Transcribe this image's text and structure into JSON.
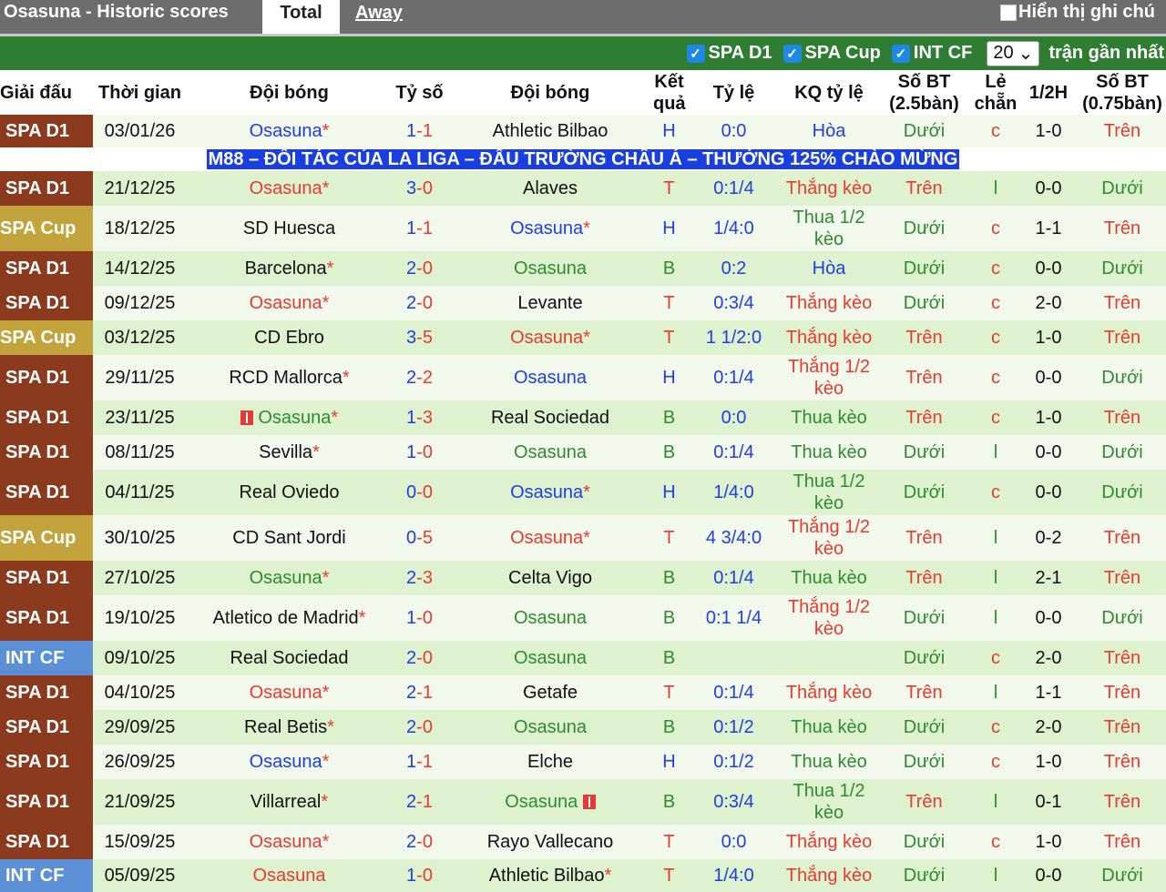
{
  "header": {
    "title": "Osasuna - Historic scores",
    "tab_total": "Total",
    "tab_away": "Away",
    "show_notes": "Hiển thị ghi chú"
  },
  "filters": {
    "spa_d1": "SPA D1",
    "spa_cup": "SPA Cup",
    "int_cf": "INT CF",
    "count": "20",
    "recent_label": "trận gần nhất"
  },
  "columns": [
    "Giải đấu",
    "Thời gian",
    "Đội bóng",
    "Tỷ số",
    "Đội bóng",
    "Kết quả",
    "Tỷ lệ",
    "KQ tỷ lệ",
    "Số BT (2.5bàn)",
    "Lẻ chẵn",
    "1/2H",
    "Số BT (0.75bàn)"
  ],
  "ad_banner": "M88 – ĐỐI TÁC CỦA LA LIGA – ĐẤU TRƯỜNG CHÂU Á – THƯỞNG 125% CHÀO MỪNG",
  "colors": {
    "spa_d1": "#8b3a1e",
    "spa_cup": "#c3a33b",
    "int_cf": "#5b8fd6",
    "blue": "#1e3ee6",
    "red": "#e63b2e",
    "green": "#2e8b2e"
  },
  "rows": [
    {
      "league": "SPA D1",
      "date": "03/01/26",
      "home": "Osasuna",
      "home_star": "*",
      "home_c": "blue",
      "score_a": "1",
      "score_b": "1",
      "away": "Athletic Bilbao",
      "away_star": "",
      "away_c": "dark",
      "result": "H",
      "result_c": "blue",
      "odds": "0:0",
      "odds_c": "blue",
      "kq": "Hòa",
      "kq_c": "blue",
      "bt25": "Dưới",
      "bt25_c": "green",
      "le": "c",
      "le_c": "red",
      "half": "1-0",
      "bt075": "Trên",
      "bt075_c": "red",
      "h": 36
    },
    {
      "ad": true
    },
    {
      "league": "SPA D1",
      "date": "21/12/25",
      "home": "Osasuna",
      "home_star": "*",
      "home_c": "red",
      "score_a": "3",
      "score_b": "0",
      "away": "Alaves",
      "away_star": "",
      "away_c": "dark",
      "result": "T",
      "result_c": "red",
      "odds": "0:1/4",
      "odds_c": "blue",
      "kq": "Thắng kèo",
      "kq_c": "red",
      "bt25": "Trên",
      "bt25_c": "red",
      "le": "l",
      "le_c": "green",
      "half": "0-0",
      "bt075": "Dưới",
      "bt075_c": "green",
      "h": 38
    },
    {
      "league": "SPA Cup",
      "date": "18/12/25",
      "home": "SD Huesca",
      "home_star": "",
      "home_c": "dark",
      "score_a": "1",
      "score_b": "1",
      "away": "Osasuna",
      "away_star": "*",
      "away_c": "blue",
      "result": "H",
      "result_c": "blue",
      "odds": "1/4:0",
      "odds_c": "blue",
      "kq": "Thua 1/2 kèo",
      "kq_c": "green",
      "bt25": "Dưới",
      "bt25_c": "green",
      "le": "c",
      "le_c": "red",
      "half": "1-1",
      "bt075": "Trên",
      "bt075_c": "red",
      "h": 50
    },
    {
      "league": "SPA D1",
      "date": "14/12/25",
      "home": "Barcelona",
      "home_star": "*",
      "home_c": "dark",
      "score_a": "2",
      "score_b": "0",
      "away": "Osasuna",
      "away_star": "",
      "away_c": "green",
      "result": "B",
      "result_c": "green",
      "odds": "0:2",
      "odds_c": "blue",
      "kq": "Hòa",
      "kq_c": "blue",
      "bt25": "Dưới",
      "bt25_c": "green",
      "le": "c",
      "le_c": "red",
      "half": "0-0",
      "bt075": "Dưới",
      "bt075_c": "green",
      "h": 38
    },
    {
      "league": "SPA D1",
      "date": "09/12/25",
      "home": "Osasuna",
      "home_star": "*",
      "home_c": "red",
      "score_a": "2",
      "score_b": "0",
      "away": "Levante",
      "away_star": "",
      "away_c": "dark",
      "result": "T",
      "result_c": "red",
      "odds": "0:3/4",
      "odds_c": "blue",
      "kq": "Thắng kèo",
      "kq_c": "red",
      "bt25": "Dưới",
      "bt25_c": "green",
      "le": "c",
      "le_c": "red",
      "half": "2-0",
      "bt075": "Trên",
      "bt075_c": "red",
      "h": 38
    },
    {
      "league": "SPA Cup",
      "date": "03/12/25",
      "home": "CD Ebro",
      "home_star": "",
      "home_c": "dark",
      "score_a": "3",
      "score_b": "5",
      "away": "Osasuna",
      "away_star": "*",
      "away_c": "red",
      "result": "T",
      "result_c": "red",
      "odds": "1 1/2:0",
      "odds_c": "blue",
      "kq": "Thắng kèo",
      "kq_c": "red",
      "bt25": "Trên",
      "bt25_c": "red",
      "le": "c",
      "le_c": "red",
      "half": "1-0",
      "bt075": "Trên",
      "bt075_c": "red",
      "h": 38
    },
    {
      "league": "SPA D1",
      "date": "29/11/25",
      "home": "RCD Mallorca",
      "home_star": "*",
      "home_c": "dark",
      "score_a": "2",
      "score_b": "2",
      "away": "Osasuna",
      "away_star": "",
      "away_c": "blue",
      "result": "H",
      "result_c": "blue",
      "odds": "0:1/4",
      "odds_c": "blue",
      "kq": "Thắng 1/2 kèo",
      "kq_c": "red",
      "bt25": "Trên",
      "bt25_c": "red",
      "le": "c",
      "le_c": "red",
      "half": "0-0",
      "bt075": "Dưới",
      "bt075_c": "green",
      "h": 50
    },
    {
      "league": "SPA D1",
      "date": "23/11/25",
      "home": "Osasuna",
      "home_star": "*",
      "home_c": "green",
      "home_flag": true,
      "score_a": "1",
      "score_b": "3",
      "away": "Real Sociedad",
      "away_star": "",
      "away_c": "dark",
      "result": "B",
      "result_c": "green",
      "odds": "0:0",
      "odds_c": "blue",
      "kq": "Thua kèo",
      "kq_c": "green",
      "bt25": "Trên",
      "bt25_c": "red",
      "le": "c",
      "le_c": "red",
      "half": "1-0",
      "bt075": "Trên",
      "bt075_c": "red",
      "h": 38
    },
    {
      "league": "SPA D1",
      "date": "08/11/25",
      "home": "Sevilla",
      "home_star": "*",
      "home_c": "dark",
      "score_a": "1",
      "score_b": "0",
      "away": "Osasuna",
      "away_star": "",
      "away_c": "green",
      "result": "B",
      "result_c": "green",
      "odds": "0:1/4",
      "odds_c": "blue",
      "kq": "Thua kèo",
      "kq_c": "green",
      "bt25": "Dưới",
      "bt25_c": "green",
      "le": "l",
      "le_c": "green",
      "half": "0-0",
      "bt075": "Dưới",
      "bt075_c": "green",
      "h": 38
    },
    {
      "league": "SPA D1",
      "date": "04/11/25",
      "home": "Real Oviedo",
      "home_star": "",
      "home_c": "dark",
      "score_a": "0",
      "score_b": "0",
      "away": "Osasuna",
      "away_star": "*",
      "away_c": "blue",
      "result": "H",
      "result_c": "blue",
      "odds": "1/4:0",
      "odds_c": "blue",
      "kq": "Thua 1/2 kèo",
      "kq_c": "green",
      "bt25": "Dưới",
      "bt25_c": "green",
      "le": "c",
      "le_c": "red",
      "half": "0-0",
      "bt075": "Dưới",
      "bt075_c": "green",
      "h": 50
    },
    {
      "league": "SPA Cup",
      "date": "30/10/25",
      "home": "CD Sant Jordi",
      "home_star": "",
      "home_c": "dark",
      "score_a": "0",
      "score_b": "5",
      "away": "Osasuna",
      "away_star": "*",
      "away_c": "red",
      "result": "T",
      "result_c": "red",
      "odds": "4 3/4:0",
      "odds_c": "blue",
      "kq": "Thắng 1/2 kèo",
      "kq_c": "red",
      "bt25": "Trên",
      "bt25_c": "red",
      "le": "l",
      "le_c": "green",
      "half": "0-2",
      "bt075": "Trên",
      "bt075_c": "red",
      "h": 50
    },
    {
      "league": "SPA D1",
      "date": "27/10/25",
      "home": "Osasuna",
      "home_star": "*",
      "home_c": "green",
      "score_a": "2",
      "score_b": "3",
      "away": "Celta Vigo",
      "away_star": "",
      "away_c": "dark",
      "result": "B",
      "result_c": "green",
      "odds": "0:1/4",
      "odds_c": "blue",
      "kq": "Thua kèo",
      "kq_c": "green",
      "bt25": "Trên",
      "bt25_c": "red",
      "le": "l",
      "le_c": "green",
      "half": "2-1",
      "bt075": "Trên",
      "bt075_c": "red",
      "h": 38
    },
    {
      "league": "SPA D1",
      "date": "19/10/25",
      "home": "Atletico de Madrid",
      "home_star": "*",
      "home_c": "dark",
      "score_a": "1",
      "score_b": "0",
      "away": "Osasuna",
      "away_star": "",
      "away_c": "green",
      "result": "B",
      "result_c": "green",
      "odds": "0:1 1/4",
      "odds_c": "blue",
      "kq": "Thắng 1/2 kèo",
      "kq_c": "red",
      "bt25": "Dưới",
      "bt25_c": "green",
      "le": "l",
      "le_c": "green",
      "half": "0-0",
      "bt075": "Dưới",
      "bt075_c": "green",
      "h": 50
    },
    {
      "league": "INT CF",
      "date": "09/10/25",
      "home": "Real Sociedad",
      "home_star": "",
      "home_c": "dark",
      "score_a": "2",
      "score_b": "0",
      "away": "Osasuna",
      "away_star": "",
      "away_c": "green",
      "result": "B",
      "result_c": "green",
      "odds": "",
      "odds_c": "blue",
      "kq": "",
      "kq_c": "green",
      "bt25": "Dưới",
      "bt25_c": "green",
      "le": "c",
      "le_c": "red",
      "half": "2-0",
      "bt075": "Trên",
      "bt075_c": "red",
      "h": 38
    },
    {
      "league": "SPA D1",
      "date": "04/10/25",
      "home": "Osasuna",
      "home_star": "*",
      "home_c": "red",
      "score_a": "2",
      "score_b": "1",
      "away": "Getafe",
      "away_star": "",
      "away_c": "dark",
      "result": "T",
      "result_c": "red",
      "odds": "0:1/4",
      "odds_c": "blue",
      "kq": "Thắng kèo",
      "kq_c": "red",
      "bt25": "Trên",
      "bt25_c": "red",
      "le": "l",
      "le_c": "green",
      "half": "1-1",
      "bt075": "Trên",
      "bt075_c": "red",
      "h": 38
    },
    {
      "league": "SPA D1",
      "date": "29/09/25",
      "home": "Real Betis",
      "home_star": "*",
      "home_c": "dark",
      "score_a": "2",
      "score_b": "0",
      "away": "Osasuna",
      "away_star": "",
      "away_c": "green",
      "result": "B",
      "result_c": "green",
      "odds": "0:1/2",
      "odds_c": "blue",
      "kq": "Thua kèo",
      "kq_c": "green",
      "bt25": "Dưới",
      "bt25_c": "green",
      "le": "c",
      "le_c": "red",
      "half": "2-0",
      "bt075": "Trên",
      "bt075_c": "red",
      "h": 38
    },
    {
      "league": "SPA D1",
      "date": "26/09/25",
      "home": "Osasuna",
      "home_star": "*",
      "home_c": "blue",
      "score_a": "1",
      "score_b": "1",
      "away": "Elche",
      "away_star": "",
      "away_c": "dark",
      "result": "H",
      "result_c": "blue",
      "odds": "0:1/2",
      "odds_c": "blue",
      "kq": "Thua kèo",
      "kq_c": "green",
      "bt25": "Dưới",
      "bt25_c": "green",
      "le": "c",
      "le_c": "red",
      "half": "1-0",
      "bt075": "Trên",
      "bt075_c": "red",
      "h": 38
    },
    {
      "league": "SPA D1",
      "date": "21/09/25",
      "home": "Villarreal",
      "home_star": "*",
      "home_c": "dark",
      "score_a": "2",
      "score_b": "1",
      "away": "Osasuna",
      "away_star": "",
      "away_c": "green",
      "away_flag": true,
      "result": "B",
      "result_c": "green",
      "odds": "0:3/4",
      "odds_c": "blue",
      "kq": "Thua 1/2 kèo",
      "kq_c": "green",
      "bt25": "Trên",
      "bt25_c": "red",
      "le": "l",
      "le_c": "green",
      "half": "0-1",
      "bt075": "Trên",
      "bt075_c": "red",
      "h": 50
    },
    {
      "league": "SPA D1",
      "date": "15/09/25",
      "home": "Osasuna",
      "home_star": "*",
      "home_c": "red",
      "score_a": "2",
      "score_b": "0",
      "away": "Rayo Vallecano",
      "away_star": "",
      "away_c": "dark",
      "result": "T",
      "result_c": "red",
      "odds": "0:0",
      "odds_c": "blue",
      "kq": "Thắng kèo",
      "kq_c": "red",
      "bt25": "Dưới",
      "bt25_c": "green",
      "le": "c",
      "le_c": "red",
      "half": "1-0",
      "bt075": "Trên",
      "bt075_c": "red",
      "h": 38
    },
    {
      "league": "INT CF",
      "date": "05/09/25",
      "home": "Osasuna",
      "home_star": "",
      "home_c": "red",
      "score_a": "1",
      "score_b": "0",
      "away": "Athletic Bilbao",
      "away_star": "*",
      "away_c": "dark",
      "result": "T",
      "result_c": "red",
      "odds": "1/4:0",
      "odds_c": "blue",
      "kq": "Thắng kèo",
      "kq_c": "red",
      "bt25": "Dưới",
      "bt25_c": "green",
      "le": "l",
      "le_c": "green",
      "half": "0-0",
      "bt075": "Dưới",
      "bt075_c": "green",
      "h": 36
    }
  ]
}
